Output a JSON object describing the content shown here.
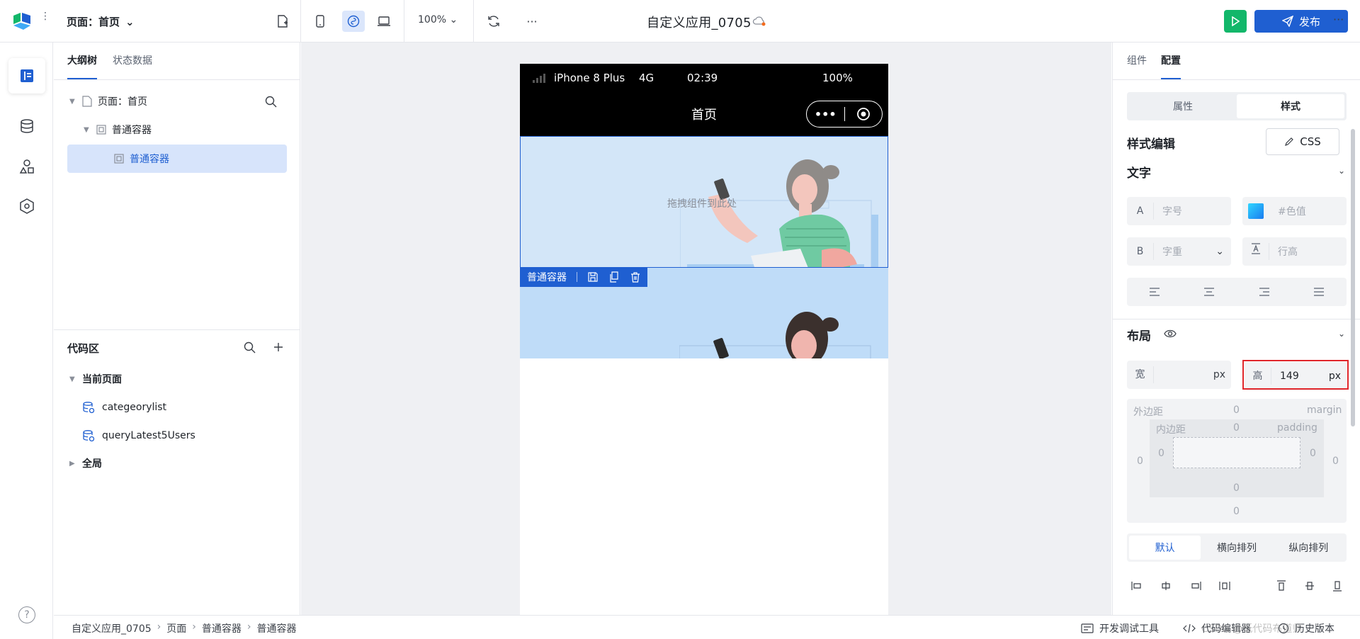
{
  "header": {
    "page_selector": "页面：首页",
    "zoom": "100%",
    "app_title": "自定义应用_0705",
    "publish_label": "发布"
  },
  "outline": {
    "tabs": [
      "大纲树",
      "状态数据"
    ],
    "tree": [
      {
        "label": "页面：首页"
      },
      {
        "label": "普通容器"
      },
      {
        "label": "普通容器"
      }
    ],
    "code_title": "代码区",
    "code_items": [
      {
        "label": "当前页面"
      },
      {
        "label": "categeorylist"
      },
      {
        "label": "queryLatest5Users"
      },
      {
        "label": "全局"
      }
    ]
  },
  "phone": {
    "device": "iPhone 8 Plus",
    "network": "4G",
    "time": "02:39",
    "battery": "100%",
    "nav_title": "首页",
    "drop_hint": "拖拽组件到此处",
    "selected_label": "普通容器"
  },
  "config": {
    "tabs": [
      "组件",
      "配置"
    ],
    "segments": [
      "属性",
      "样式"
    ],
    "style_title": "样式编辑",
    "css_label": "CSS",
    "text_title": "文字",
    "font_size_lead": "A",
    "font_size_ph": "字号",
    "color_ph": "#色值",
    "weight_lead": "B",
    "weight_ph": "字重",
    "line_height_ph": "行高",
    "layout_title": "布局",
    "width_label": "宽",
    "width_unit": "px",
    "height_label": "高",
    "height_value": "149",
    "height_unit": "px",
    "margin_label": "外边距",
    "margin_en": "margin",
    "padding_label": "内边距",
    "padding_en": "padding",
    "zero": "0",
    "layout_modes": [
      "默认",
      "横向排列",
      "纵向排列"
    ]
  },
  "footer": {
    "breadcrumbs": [
      "自定义应用_0705",
      "页面",
      "普通容器",
      "普通容器"
    ],
    "dev_tools": "开发调试工具",
    "code_editor": "代码编辑器",
    "history": "历史版本",
    "watermark": "CSDN @低代码布道师"
  },
  "colors": {
    "primary": "#1f5fd1",
    "run": "#12b76a",
    "selected_bg": "#d7e4fb",
    "highlight": "#e0262b"
  }
}
